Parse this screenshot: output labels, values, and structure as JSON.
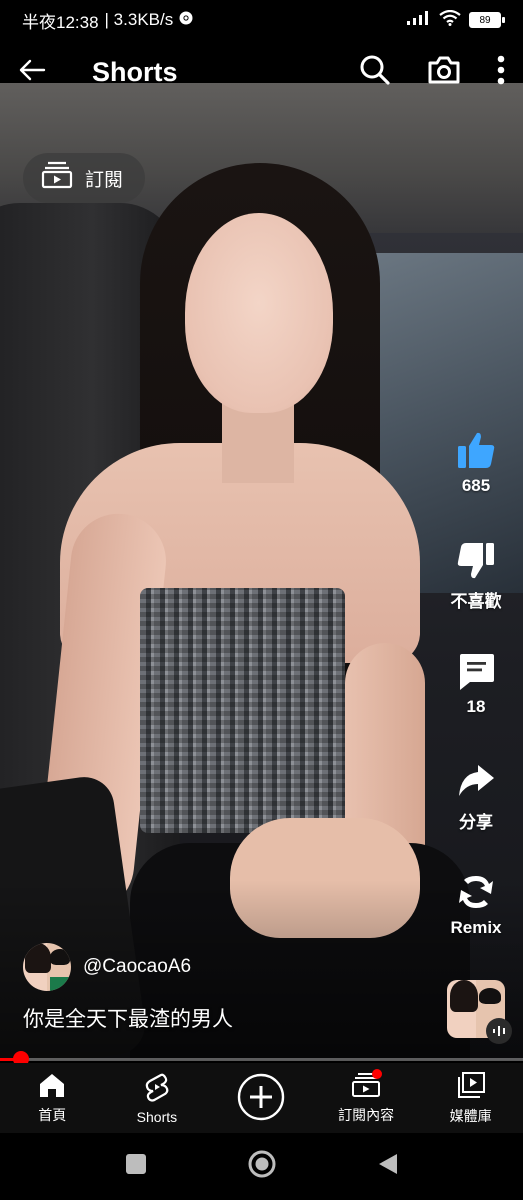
{
  "status_bar": {
    "time": "半夜12:38",
    "network_speed": "| 3.3KB/s",
    "battery": "89"
  },
  "header": {
    "title": "Shorts"
  },
  "subscribe_chip": {
    "label": "訂閱"
  },
  "actions": {
    "like_count": "685",
    "dislike_label": "不喜歡",
    "comment_count": "18",
    "share_label": "分享",
    "remix_label": "Remix"
  },
  "channel": {
    "handle": "@CaocaoA6"
  },
  "caption": "你是全天下最渣的男人",
  "progress": {
    "fraction": 0.04,
    "color": "#ff0000"
  },
  "bottom_nav": {
    "items": [
      {
        "label": "首頁",
        "icon": "home-icon"
      },
      {
        "label": "Shorts",
        "icon": "shorts-icon"
      },
      {
        "label": "",
        "icon": "create-icon"
      },
      {
        "label": "訂閱內容",
        "icon": "subscriptions-icon"
      },
      {
        "label": "媒體庫",
        "icon": "library-icon"
      }
    ]
  },
  "colors": {
    "like_blue": "#3ea6ff",
    "accent_red": "#ff0000"
  }
}
